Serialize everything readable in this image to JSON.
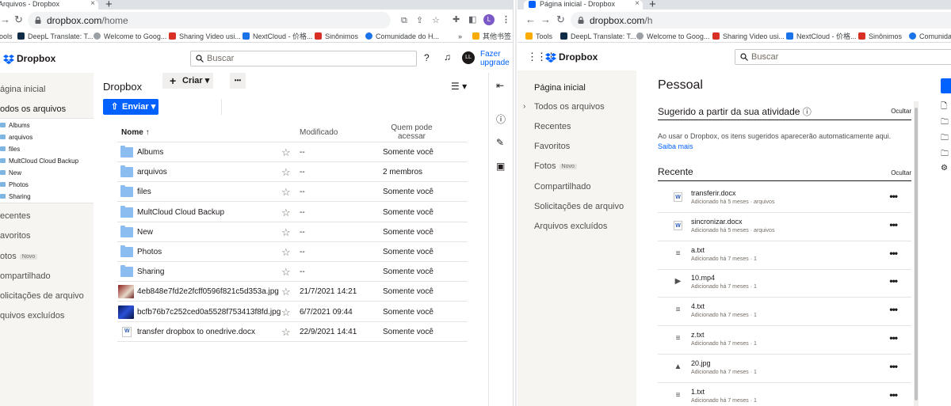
{
  "left": {
    "tab_title": "Arquivos - Dropbox",
    "url_host": "dropbox.com",
    "url_path": "/home",
    "profile_initial": "L",
    "bookmarks": [
      "ools",
      "DeepL Translate: T...",
      "Welcome to Goog...",
      "Sharing Video usi...",
      "NextCloud - 价格...",
      "Sinônimos",
      "Comunidade do H...",
      "其他书签"
    ],
    "bookmarks_more": "»",
    "logo_text": "Dropbox",
    "search_placeholder": "Buscar",
    "user_initials": "LL",
    "upgrade_line1": "Fazer",
    "upgrade_line2": "upgrade",
    "sidebar": {
      "home": "ágina inicial",
      "all_files": "odos os arquivos",
      "sub_items": [
        "Albums",
        "arquivos",
        "files",
        "MultCloud Cloud Backup",
        "New",
        "Photos",
        "Sharing"
      ],
      "recents": "ecentes",
      "starred": "avoritos",
      "photos": "otos",
      "photos_badge": "Novo",
      "shared": "ompartilhado",
      "requests": "olicitações de arquivo",
      "deleted": "quivos excluídos"
    },
    "breadcrumb": "Dropbox",
    "upload_label": "Enviar",
    "create_label": "Criar",
    "more_label": "•••",
    "columns": {
      "name": "Nome",
      "modified": "Modificado",
      "access_line1": "Quem pode",
      "access_line2": "acessar"
    },
    "rows": [
      {
        "name": "Albums",
        "modified": "--",
        "access": "Somente você",
        "kind": "folder"
      },
      {
        "name": "arquivos",
        "modified": "--",
        "access": "2 membros",
        "kind": "shared-folder"
      },
      {
        "name": "files",
        "modified": "--",
        "access": "Somente você",
        "kind": "folder"
      },
      {
        "name": "MultCloud Cloud Backup",
        "modified": "--",
        "access": "Somente você",
        "kind": "folder"
      },
      {
        "name": "New",
        "modified": "--",
        "access": "Somente você",
        "kind": "folder"
      },
      {
        "name": "Photos",
        "modified": "--",
        "access": "Somente você",
        "kind": "folder"
      },
      {
        "name": "Sharing",
        "modified": "--",
        "access": "Somente você",
        "kind": "folder"
      },
      {
        "name": "4eb848e7fd2e2fcff0596f821c5d353a.jpg",
        "modified": "21/7/2021 14:21",
        "access": "Somente você",
        "kind": "image-red"
      },
      {
        "name": "bcfb76b7c252ced0a5528f753413f8fd.jpg",
        "modified": "6/7/2021 09:44",
        "access": "Somente você",
        "kind": "image-blue"
      },
      {
        "name": "transfer dropbox to onedrive.docx",
        "modified": "22/9/2021 14:41",
        "access": "Somente você",
        "kind": "docx"
      }
    ]
  },
  "right": {
    "tab_title": "Página inicial - Dropbox",
    "url_host": "dropbox.com",
    "url_path": "/h",
    "bookmarks": [
      "Tools",
      "DeepL Translate: T...",
      "Welcome to Goog...",
      "Sharing Video usi...",
      "NextCloud - 价格...",
      "Sinônimos",
      "Comunidad"
    ],
    "logo_text": "Dropbox",
    "search_placeholder": "Buscar",
    "nav": {
      "home": "Página inicial",
      "all_files": "Todos os arquivos",
      "recents": "Recentes",
      "starred": "Favoritos",
      "photos": "Fotos",
      "photos_badge": "Novo",
      "shared": "Compartilhado",
      "requests": "Solicitações de arquivo",
      "deleted": "Arquivos excluídos"
    },
    "title": "Pessoal",
    "suggested_heading": "Sugerido a partir da sua atividade",
    "hide_label": "Ocultar",
    "hint_text": "Ao usar o Dropbox, os itens sugeridos aparecerão automaticamente aqui.",
    "hint_link": "Saiba mais",
    "recent_heading": "Recente",
    "recent_hide_label": "Ocultar",
    "recent": [
      {
        "title": "transferir.docx",
        "subtitle": "Adicionado há 5 meses · arquivos",
        "icon": "docx"
      },
      {
        "title": "sincronizar.docx",
        "subtitle": "Adicionado há 5 meses · arquivos",
        "icon": "docx"
      },
      {
        "title": "a.txt",
        "subtitle": "Adicionado há 7 meses · 1",
        "icon": "txt"
      },
      {
        "title": "10.mp4",
        "subtitle": "Adicionado há 7 meses · 1",
        "icon": "video"
      },
      {
        "title": "4.txt",
        "subtitle": "Adicionado há 7 meses · 1",
        "icon": "txt"
      },
      {
        "title": "z.txt",
        "subtitle": "Adicionado há 7 meses · 1",
        "icon": "txt"
      },
      {
        "title": "20.jpg",
        "subtitle": "Adicionado há 7 meses · 1",
        "icon": "image"
      },
      {
        "title": "1.txt",
        "subtitle": "Adicionado há 7 meses · 1",
        "icon": "txt"
      }
    ]
  },
  "colors": {
    "accent": "#0061fe",
    "sidebar_bg": "#f7f5f2",
    "folder": "#8bbdf0"
  }
}
